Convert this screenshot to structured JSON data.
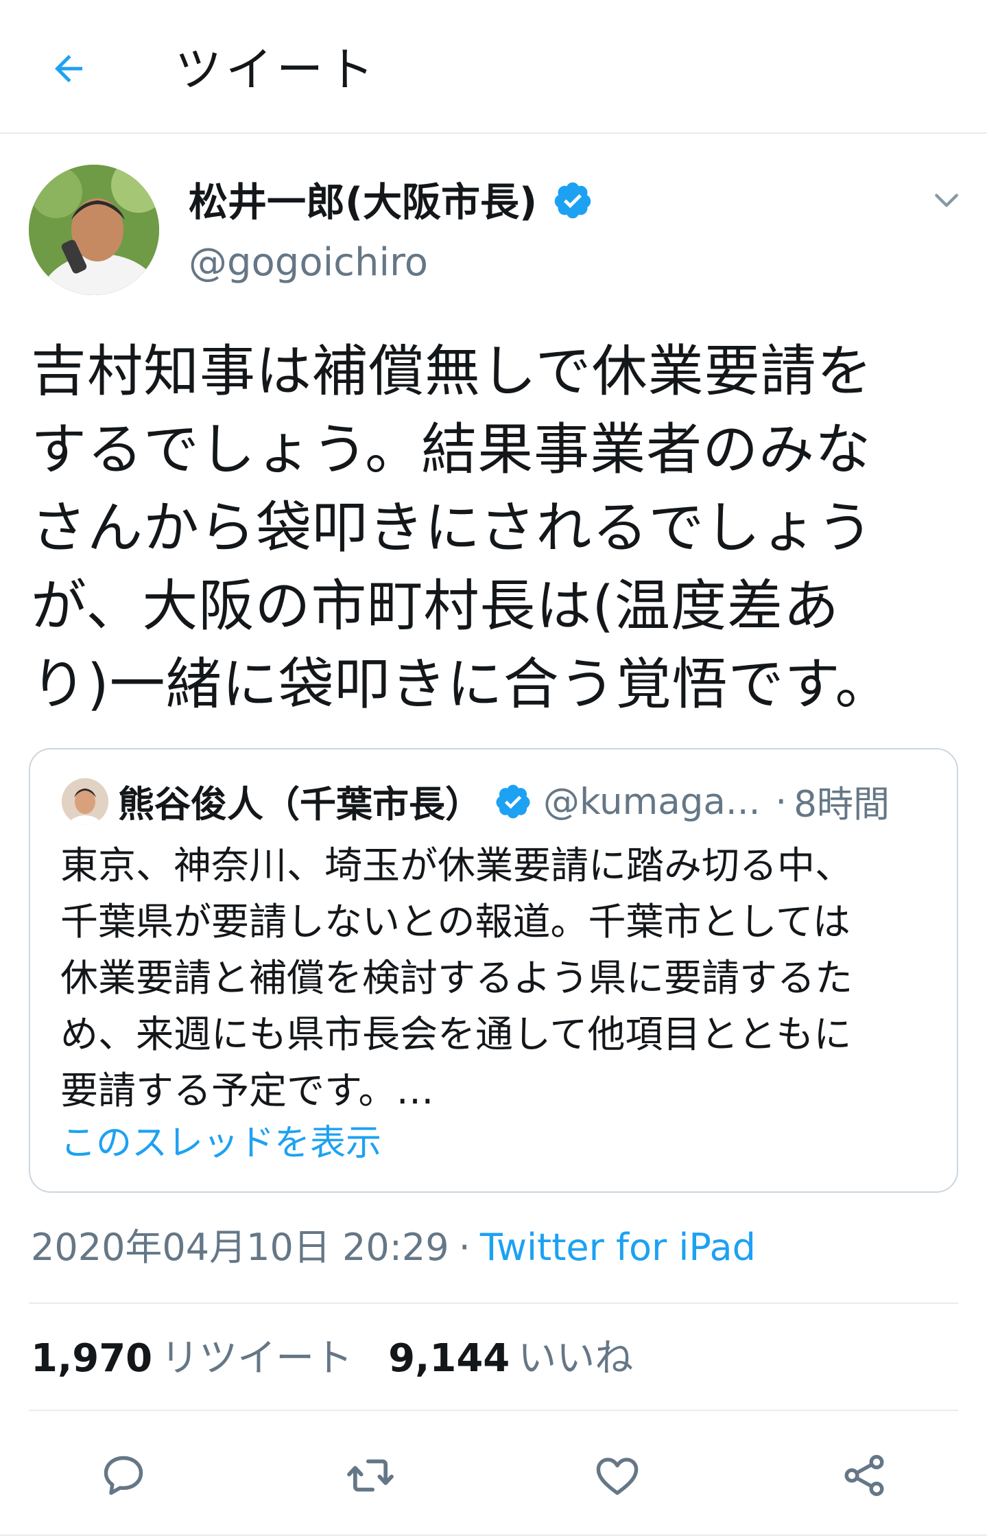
{
  "header": {
    "title": "ツイート",
    "back_icon": "arrow-left-icon"
  },
  "tweet": {
    "author_name": "松井一郎(大阪市長)",
    "author_handle": "@gogoichiro",
    "text": "吉村知事は補償無しで休業要請を\nするでしょう。結果事業者のみな\nさんから袋叩きにされるでしょう\nが、大阪の市町村長は(温度差あ\nり)一緒に袋叩きに合う覚悟です。",
    "verified_icon": "verified-badge-icon",
    "more_icon": "chevron-down-icon"
  },
  "quote": {
    "author_name": "熊谷俊人（千葉市長）",
    "author_handle": "@kumaga...",
    "separator": "·",
    "time": "8時間",
    "text": "東京、神奈川、埼玉が休業要請に踏み切る中、\n千葉県が要請しないとの報道。千葉市としては\n休業要請と補償を検討するよう県に要請するた\nめ、来週にも県市長会を通して他項目とともに\n要請する予定です。…",
    "thread_link": "このスレッドを表示"
  },
  "meta": {
    "datetime": "2020年04月10日 20:29",
    "separator": "·",
    "source": "Twitter for iPad"
  },
  "stats": {
    "retweets_count": "1,970",
    "retweets_label": "リツイート",
    "likes_count": "9,144",
    "likes_label": "いいね"
  },
  "actions": [
    "reply-icon",
    "retweet-icon",
    "like-icon",
    "share-icon"
  ],
  "colors": {
    "accent": "#1da1f2",
    "text_primary": "#14171a",
    "text_secondary": "#657786",
    "border": "#e6ecf0"
  }
}
